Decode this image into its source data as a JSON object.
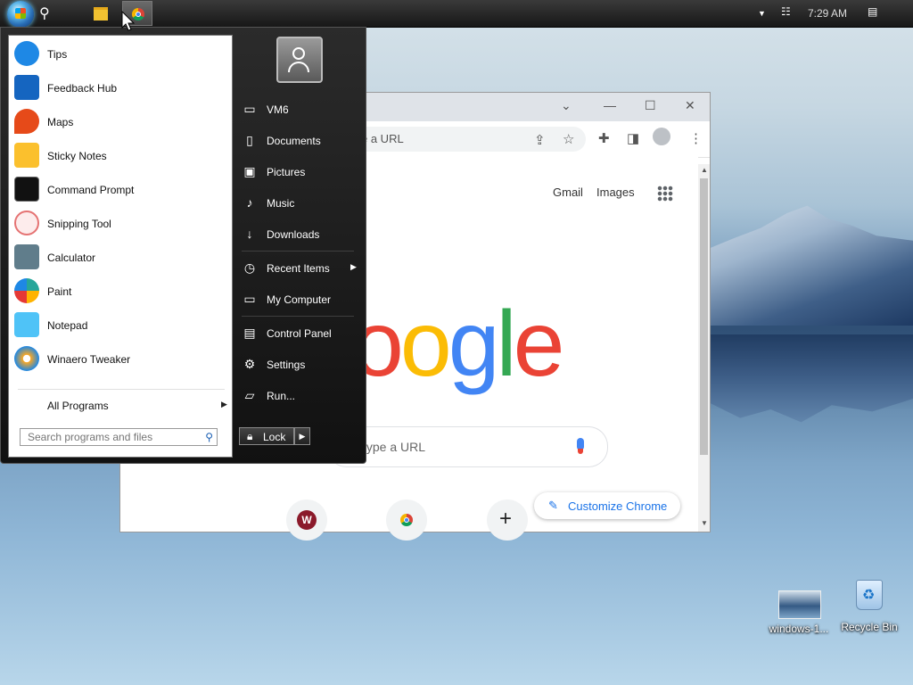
{
  "taskbar": {
    "clock": "7:29 AM"
  },
  "chrome": {
    "omnibox_partial": "e a URL",
    "links": [
      "Gmail",
      "Images"
    ],
    "logo_letters": [
      "o",
      "o",
      "g",
      "l",
      "e"
    ],
    "logo_colors": [
      "#ea4335",
      "#fbbc05",
      "#4285f4",
      "#34a853",
      "#ea4335"
    ],
    "search_placeholder": "type a URL",
    "shortcut_initial": "W",
    "customize_label": "Customize Chrome"
  },
  "start_menu": {
    "apps": [
      {
        "label": "Tips",
        "icon": "lightbulb-icon",
        "color": "#1e88e5"
      },
      {
        "label": "Feedback Hub",
        "icon": "feedback-hub-icon",
        "color": "#1565c0"
      },
      {
        "label": "Maps",
        "icon": "maps-pin-icon",
        "color": "#e64a19"
      },
      {
        "label": "Sticky Notes",
        "icon": "sticky-notes-icon",
        "color": "#fbc02d"
      },
      {
        "label": "Command Prompt",
        "icon": "command-prompt-icon",
        "color": "#111111"
      },
      {
        "label": "Snipping Tool",
        "icon": "snipping-tool-icon",
        "color": "#e57373"
      },
      {
        "label": "Calculator",
        "icon": "calculator-icon",
        "color": "#607d8b"
      },
      {
        "label": "Paint",
        "icon": "paint-palette-icon",
        "color": "#26a69a"
      },
      {
        "label": "Notepad",
        "icon": "notepad-icon",
        "color": "#4fc3f7"
      },
      {
        "label": "Winaero Tweaker",
        "icon": "winaero-tweaker-icon",
        "color": "#f9a825"
      }
    ],
    "all_programs": "All Programs",
    "search_placeholder": "Search programs and files",
    "right_items": [
      {
        "label": "VM6",
        "icon": "user-folder-icon"
      },
      {
        "label": "Documents",
        "icon": "documents-icon"
      },
      {
        "label": "Pictures",
        "icon": "pictures-icon"
      },
      {
        "label": "Music",
        "icon": "music-icon"
      },
      {
        "label": "Downloads",
        "icon": "downloads-icon"
      },
      {
        "label": "Recent Items",
        "icon": "recent-items-icon"
      },
      {
        "label": "My Computer",
        "icon": "computer-icon"
      },
      {
        "label": "Control Panel",
        "icon": "control-panel-icon"
      },
      {
        "label": "Settings",
        "icon": "gear-icon"
      },
      {
        "label": "Run...",
        "icon": "run-icon"
      }
    ],
    "lock_label": "Lock"
  },
  "desktop_icons": [
    {
      "label": "windows-1...",
      "icon": "image-file-icon"
    },
    {
      "label": "Recycle Bin",
      "icon": "recycle-bin-icon"
    }
  ]
}
